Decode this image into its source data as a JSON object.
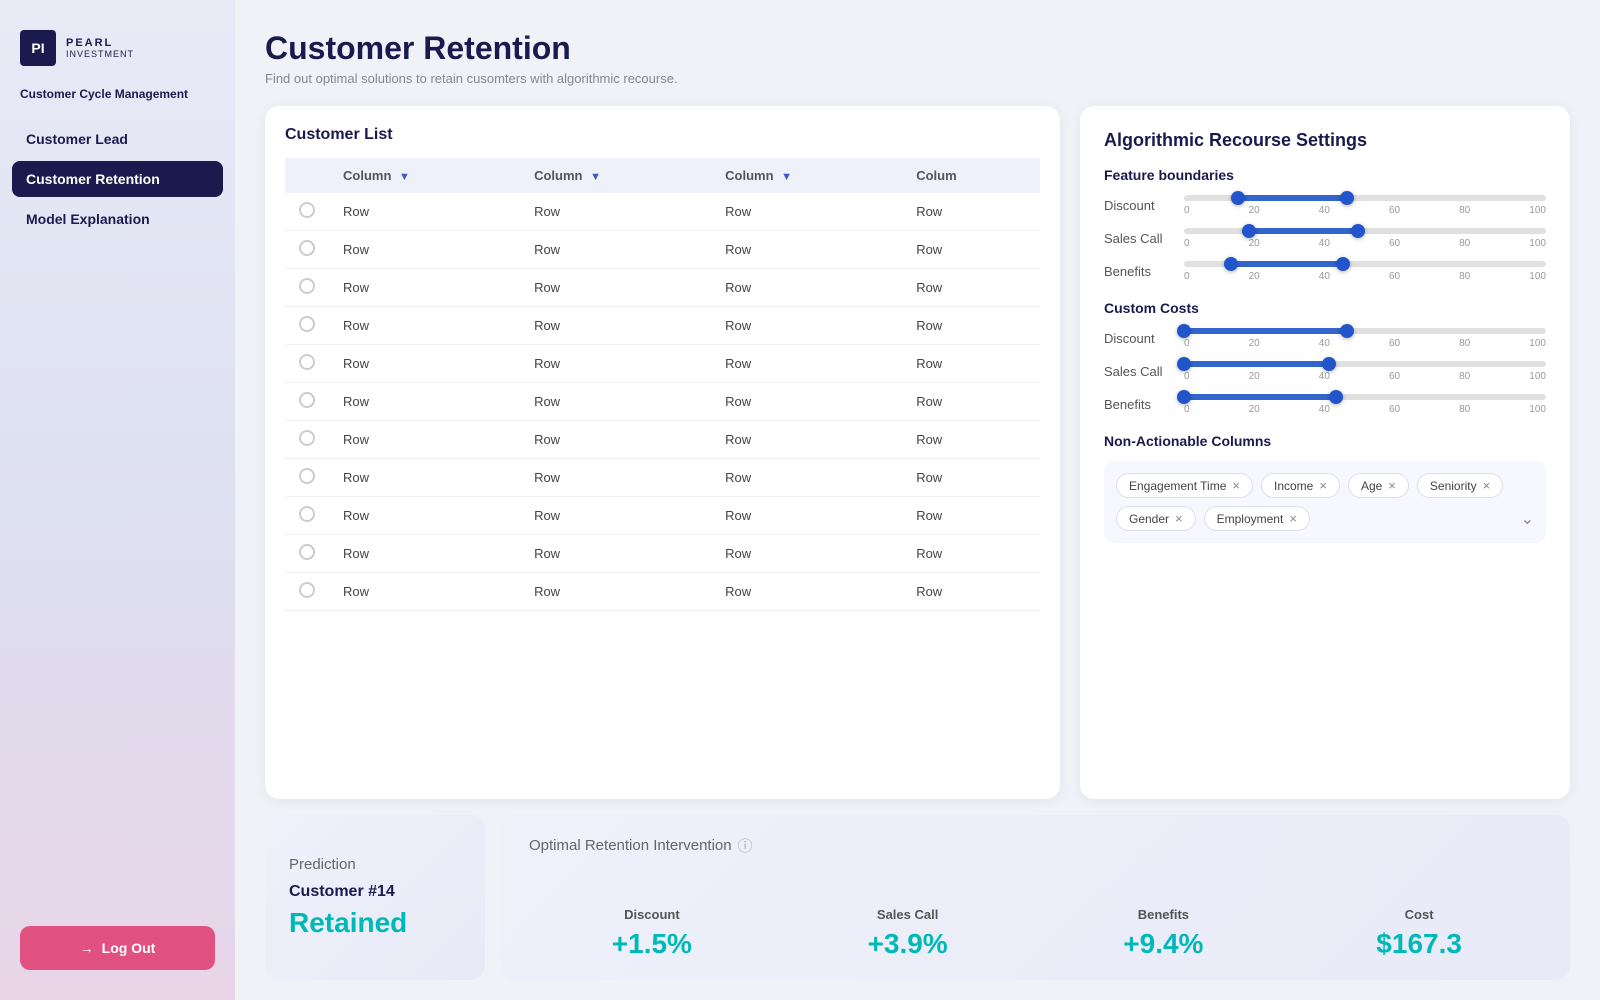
{
  "sidebar": {
    "logo": {
      "initials": "PI",
      "brand": "PEARL",
      "sub": "INVESTMENT"
    },
    "section_title": "Customer Cycle Management",
    "items": [
      {
        "label": "Customer Lead",
        "active": false
      },
      {
        "label": "Customer Retention",
        "active": true
      },
      {
        "label": "Model Explanation",
        "active": false
      }
    ],
    "logout_label": "Log Out"
  },
  "header": {
    "title": "Customer Retention",
    "subtitle": "Find out optimal solutions to retain cusomters with algorithmic recourse."
  },
  "customer_list": {
    "title": "Customer List",
    "columns": [
      "Column",
      "Column",
      "Column",
      "Colum"
    ],
    "rows": [
      [
        "Row",
        "Row",
        "Row",
        "Row"
      ],
      [
        "Row",
        "Row",
        "Row",
        "Row"
      ],
      [
        "Row",
        "Row",
        "Row",
        "Row"
      ],
      [
        "Row",
        "Row",
        "Row",
        "Row"
      ],
      [
        "Row",
        "Row",
        "Row",
        "Row"
      ],
      [
        "Row",
        "Row",
        "Row",
        "Row"
      ],
      [
        "Row",
        "Row",
        "Row",
        "Row"
      ],
      [
        "Row",
        "Row",
        "Row",
        "Row"
      ],
      [
        "Row",
        "Row",
        "Row",
        "Row"
      ],
      [
        "Row",
        "Row",
        "Row",
        "Row"
      ],
      [
        "Row",
        "Row",
        "Row",
        "Row"
      ]
    ]
  },
  "settings": {
    "title": "Algorithmic Recourse Settings",
    "feature_boundaries_label": "Feature boundaries",
    "sliders_fb": [
      {
        "label": "Discount",
        "min": 0,
        "max": 100,
        "range_start": 15,
        "range_end": 45,
        "scale": [
          "0",
          "20",
          "40",
          "60",
          "80",
          "100"
        ]
      },
      {
        "label": "Sales Call",
        "min": 0,
        "max": 100,
        "range_start": 18,
        "range_end": 48,
        "scale": [
          "0",
          "20",
          "40",
          "60",
          "80",
          "100"
        ]
      },
      {
        "label": "Benefits",
        "min": 0,
        "max": 100,
        "range_start": 13,
        "range_end": 44,
        "scale": [
          "0",
          "20",
          "40",
          "60",
          "80",
          "100"
        ]
      }
    ],
    "custom_costs_label": "Custom Costs",
    "sliders_cc": [
      {
        "label": "Discount",
        "min": 0,
        "max": 100,
        "range_start": 0,
        "range_end": 45,
        "scale": [
          "0",
          "20",
          "40",
          "60",
          "80",
          "100"
        ]
      },
      {
        "label": "Sales Call",
        "min": 0,
        "max": 100,
        "range_start": 0,
        "range_end": 40,
        "scale": [
          "0",
          "20",
          "40",
          "60",
          "80",
          "100"
        ]
      },
      {
        "label": "Benefits",
        "min": 0,
        "max": 100,
        "range_start": 0,
        "range_end": 42,
        "scale": [
          "0",
          "20",
          "40",
          "60",
          "80",
          "100"
        ]
      }
    ],
    "non_actionable_label": "Non-Actionable Columns",
    "tags": [
      "Engagement Time",
      "Income",
      "Age",
      "Seniority",
      "Gender",
      "Employment"
    ]
  },
  "prediction": {
    "label": "Prediction",
    "customer": "Customer #14",
    "status": "Retained"
  },
  "intervention": {
    "title": "Optimal Retention Intervention",
    "columns": [
      {
        "label": "Discount",
        "value": "+1.5%"
      },
      {
        "label": "Sales Call",
        "value": "+3.9%"
      },
      {
        "label": "Benefits",
        "value": "+9.4%"
      },
      {
        "label": "Cost",
        "value": "$167.3"
      }
    ]
  }
}
